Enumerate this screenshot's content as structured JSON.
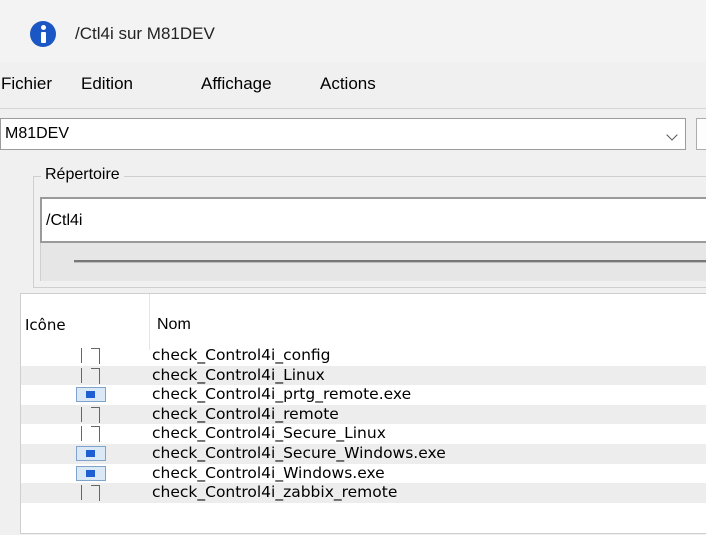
{
  "window": {
    "title": "/Ctl4i sur M81DEV",
    "app_icon": "info-icon"
  },
  "menu": {
    "items": [
      {
        "label": "Fichier"
      },
      {
        "label": "Edition"
      },
      {
        "label": "Affichage"
      },
      {
        "label": "Actions"
      }
    ]
  },
  "server": {
    "selected": "M81DEV"
  },
  "directory": {
    "group_label": "Répertoire",
    "path": "/Ctl4i"
  },
  "list": {
    "columns": [
      "Icône",
      "Nom"
    ],
    "rows": [
      {
        "icon": "document-icon",
        "name": "check_Control4i_config"
      },
      {
        "icon": "document-icon",
        "name": "check_Control4i_Linux"
      },
      {
        "icon": "executable-icon",
        "name": "check_Control4i_prtg_remote.exe"
      },
      {
        "icon": "document-icon",
        "name": "check_Control4i_remote"
      },
      {
        "icon": "document-icon",
        "name": "check_Control4i_Secure_Linux"
      },
      {
        "icon": "executable-icon",
        "name": "check_Control4i_Secure_Windows.exe"
      },
      {
        "icon": "executable-icon",
        "name": "check_Control4i_Windows.exe"
      },
      {
        "icon": "document-icon",
        "name": "check_Control4i_zabbix_remote"
      }
    ]
  }
}
